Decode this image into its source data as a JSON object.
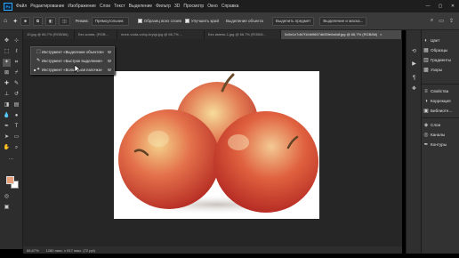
{
  "app": {
    "logo_text": "Ps",
    "menu": [
      "Файл",
      "Редактирование",
      "Изображение",
      "Слои",
      "Текст",
      "Выделение",
      "Фильтр",
      "3D",
      "Просмотр",
      "Окно",
      "Справка"
    ]
  },
  "options": {
    "feather_label": "Режим:",
    "mode_value": "Прямоугольник",
    "sample_all_layers": "Образец всех слоев",
    "auto_enhance": "Улучшить край",
    "subject_button": "Выделение объекта",
    "select_subject_btn": "Выделить предмет",
    "select_mask_btn": "Выделение и маска..."
  },
  "tabs": [
    {
      "label": "10.jpg @ 66,7% (RGB/8#)",
      "active": false
    },
    {
      "label": "Без копия, (RGB...",
      "active": false
    },
    {
      "label": "more-voda-volny-brylgi.jpg @ 66,7% ...",
      "active": false
    },
    {
      "label": "Без имени-1.jpg @ 66,7% (RGB/8...",
      "active": false
    },
    {
      "label": "0c5e1e7db7f1fdb9667db55fe0a6df.jpg @ 66,7% (RGB/8#)",
      "active": true
    }
  ],
  "flyout": {
    "items": [
      {
        "bullet": "",
        "icon": "✂",
        "label": "Инструмент «Выделение объектов»",
        "key": "W"
      },
      {
        "bullet": "",
        "icon": "✎",
        "label": "Инструмент «Быстрое выделение»",
        "key": "W"
      },
      {
        "bullet": "■",
        "icon": "✦",
        "label": "Инструмент «Волшебная палочка»",
        "key": "W"
      }
    ]
  },
  "status": {
    "zoom": "66,67%",
    "doc_size": "1280 пикс. x 917 пикс. (72 ppi)"
  },
  "panels": {
    "group1": [
      "Цвет",
      "Образцы",
      "Градиенты",
      "Узоры"
    ],
    "group2": [
      "Свойства",
      "Коррекция",
      "Библиоте..."
    ],
    "group3": [
      "Слои",
      "Каналы",
      "Контуры"
    ]
  },
  "colors": {
    "foreground": "#e7a07a",
    "background": "#ffffff",
    "accent": "#31a8ff"
  }
}
